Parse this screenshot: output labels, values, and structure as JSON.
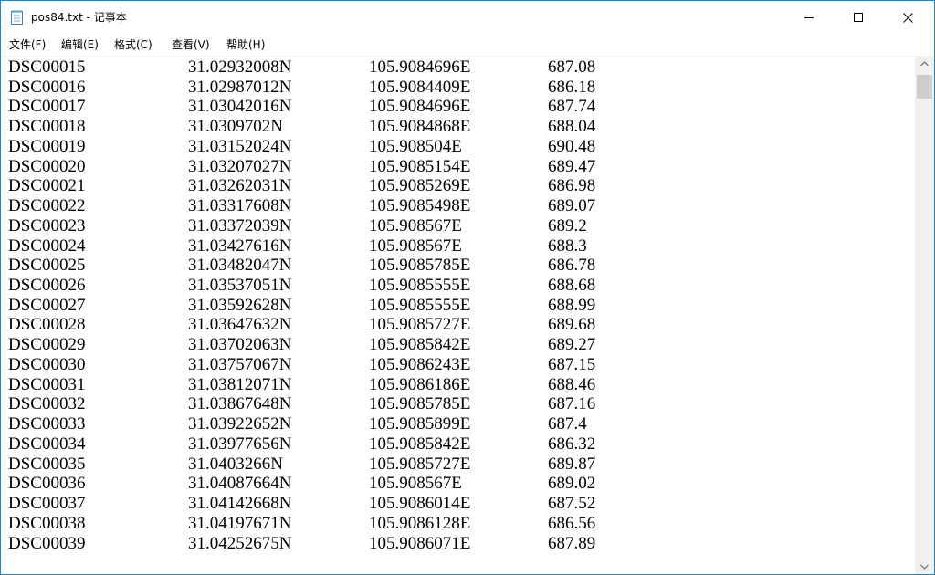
{
  "window": {
    "title": "pos84.txt - 记事本",
    "icon": "notepad-icon"
  },
  "controls": {
    "minimize_icon": "minimize-icon",
    "maximize_icon": "maximize-icon",
    "close_icon": "close-icon"
  },
  "menu": [
    {
      "label": "文件(F)"
    },
    {
      "label": "编辑(E)"
    },
    {
      "label": "格式(C)"
    },
    {
      "label": "查看(V)"
    },
    {
      "label": "帮助(H)"
    }
  ],
  "lines": [
    [
      "DSC00015",
      "31.02932008N",
      "105.9084696E",
      "687.08"
    ],
    [
      "DSC00016",
      "31.02987012N",
      "105.9084409E",
      "686.18"
    ],
    [
      "DSC00017",
      "31.03042016N",
      "105.9084696E",
      "687.74"
    ],
    [
      "DSC00018",
      "31.0309702N",
      "105.9084868E",
      "688.04"
    ],
    [
      "DSC00019",
      "31.03152024N",
      "105.908504E",
      "690.48"
    ],
    [
      "DSC00020",
      "31.03207027N",
      "105.9085154E",
      "689.47"
    ],
    [
      "DSC00021",
      "31.03262031N",
      "105.9085269E",
      "686.98"
    ],
    [
      "DSC00022",
      "31.03317608N",
      "105.9085498E",
      "689.07"
    ],
    [
      "DSC00023",
      "31.03372039N",
      "105.908567E",
      "689.2"
    ],
    [
      "DSC00024",
      "31.03427616N",
      "105.908567E",
      "688.3"
    ],
    [
      "DSC00025",
      "31.03482047N",
      "105.9085785E",
      "686.78"
    ],
    [
      "DSC00026",
      "31.03537051N",
      "105.9085555E",
      "688.68"
    ],
    [
      "DSC00027",
      "31.03592628N",
      "105.9085555E",
      "688.99"
    ],
    [
      "DSC00028",
      "31.03647632N",
      "105.9085727E",
      "689.68"
    ],
    [
      "DSC00029",
      "31.03702063N",
      "105.9085842E",
      "689.27"
    ],
    [
      "DSC00030",
      "31.03757067N",
      "105.9086243E",
      "687.15"
    ],
    [
      "DSC00031",
      "31.03812071N",
      "105.9086186E",
      "688.46"
    ],
    [
      "DSC00032",
      "31.03867648N",
      "105.9085785E",
      "687.16"
    ],
    [
      "DSC00033",
      "31.03922652N",
      "105.9085899E",
      "687.4"
    ],
    [
      "DSC00034",
      "31.03977656N",
      "105.9085842E",
      "686.32"
    ],
    [
      "DSC00035",
      "31.0403266N",
      "105.9085727E",
      "689.87"
    ],
    [
      "DSC00036",
      "31.04087664N",
      "105.908567E",
      "689.02"
    ],
    [
      "DSC00037",
      "31.04142668N",
      "105.9086014E",
      "687.52"
    ],
    [
      "DSC00038",
      "31.04197671N",
      "105.9086128E",
      "686.56"
    ],
    [
      "DSC00039",
      "31.04252675N",
      "105.9086071E",
      "687.89"
    ]
  ],
  "scrollbar": {
    "up_icon": "scroll-up-arrow-icon",
    "down_icon": "scroll-down-arrow-icon"
  },
  "colors": {
    "border": "#1883d7",
    "text": "#000000",
    "scrollbar_track": "#f0f0f0",
    "scrollbar_thumb": "#cdcdcd"
  }
}
